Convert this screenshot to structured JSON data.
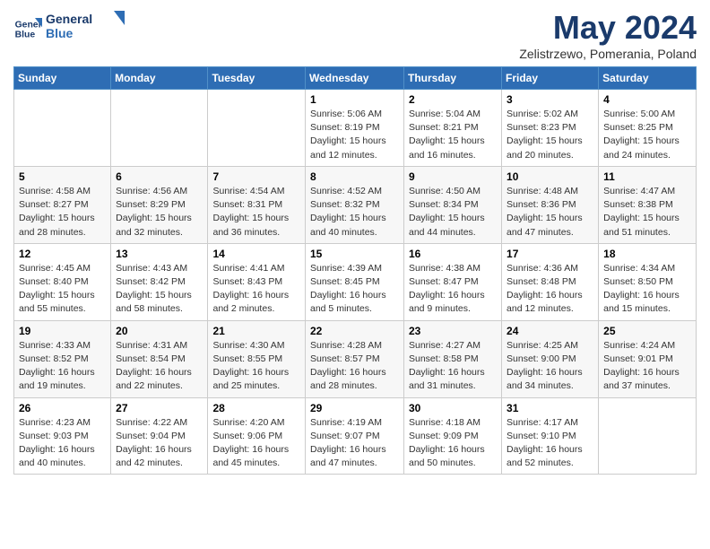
{
  "header": {
    "logo_line1": "General",
    "logo_line2": "Blue",
    "month_title": "May 2024",
    "subtitle": "Zelistrzewo, Pomerania, Poland"
  },
  "weekdays": [
    "Sunday",
    "Monday",
    "Tuesday",
    "Wednesday",
    "Thursday",
    "Friday",
    "Saturday"
  ],
  "weeks": [
    [
      {
        "day": "",
        "info": ""
      },
      {
        "day": "",
        "info": ""
      },
      {
        "day": "",
        "info": ""
      },
      {
        "day": "1",
        "info": "Sunrise: 5:06 AM\nSunset: 8:19 PM\nDaylight: 15 hours\nand 12 minutes."
      },
      {
        "day": "2",
        "info": "Sunrise: 5:04 AM\nSunset: 8:21 PM\nDaylight: 15 hours\nand 16 minutes."
      },
      {
        "day": "3",
        "info": "Sunrise: 5:02 AM\nSunset: 8:23 PM\nDaylight: 15 hours\nand 20 minutes."
      },
      {
        "day": "4",
        "info": "Sunrise: 5:00 AM\nSunset: 8:25 PM\nDaylight: 15 hours\nand 24 minutes."
      }
    ],
    [
      {
        "day": "5",
        "info": "Sunrise: 4:58 AM\nSunset: 8:27 PM\nDaylight: 15 hours\nand 28 minutes."
      },
      {
        "day": "6",
        "info": "Sunrise: 4:56 AM\nSunset: 8:29 PM\nDaylight: 15 hours\nand 32 minutes."
      },
      {
        "day": "7",
        "info": "Sunrise: 4:54 AM\nSunset: 8:31 PM\nDaylight: 15 hours\nand 36 minutes."
      },
      {
        "day": "8",
        "info": "Sunrise: 4:52 AM\nSunset: 8:32 PM\nDaylight: 15 hours\nand 40 minutes."
      },
      {
        "day": "9",
        "info": "Sunrise: 4:50 AM\nSunset: 8:34 PM\nDaylight: 15 hours\nand 44 minutes."
      },
      {
        "day": "10",
        "info": "Sunrise: 4:48 AM\nSunset: 8:36 PM\nDaylight: 15 hours\nand 47 minutes."
      },
      {
        "day": "11",
        "info": "Sunrise: 4:47 AM\nSunset: 8:38 PM\nDaylight: 15 hours\nand 51 minutes."
      }
    ],
    [
      {
        "day": "12",
        "info": "Sunrise: 4:45 AM\nSunset: 8:40 PM\nDaylight: 15 hours\nand 55 minutes."
      },
      {
        "day": "13",
        "info": "Sunrise: 4:43 AM\nSunset: 8:42 PM\nDaylight: 15 hours\nand 58 minutes."
      },
      {
        "day": "14",
        "info": "Sunrise: 4:41 AM\nSunset: 8:43 PM\nDaylight: 16 hours\nand 2 minutes."
      },
      {
        "day": "15",
        "info": "Sunrise: 4:39 AM\nSunset: 8:45 PM\nDaylight: 16 hours\nand 5 minutes."
      },
      {
        "day": "16",
        "info": "Sunrise: 4:38 AM\nSunset: 8:47 PM\nDaylight: 16 hours\nand 9 minutes."
      },
      {
        "day": "17",
        "info": "Sunrise: 4:36 AM\nSunset: 8:48 PM\nDaylight: 16 hours\nand 12 minutes."
      },
      {
        "day": "18",
        "info": "Sunrise: 4:34 AM\nSunset: 8:50 PM\nDaylight: 16 hours\nand 15 minutes."
      }
    ],
    [
      {
        "day": "19",
        "info": "Sunrise: 4:33 AM\nSunset: 8:52 PM\nDaylight: 16 hours\nand 19 minutes."
      },
      {
        "day": "20",
        "info": "Sunrise: 4:31 AM\nSunset: 8:54 PM\nDaylight: 16 hours\nand 22 minutes."
      },
      {
        "day": "21",
        "info": "Sunrise: 4:30 AM\nSunset: 8:55 PM\nDaylight: 16 hours\nand 25 minutes."
      },
      {
        "day": "22",
        "info": "Sunrise: 4:28 AM\nSunset: 8:57 PM\nDaylight: 16 hours\nand 28 minutes."
      },
      {
        "day": "23",
        "info": "Sunrise: 4:27 AM\nSunset: 8:58 PM\nDaylight: 16 hours\nand 31 minutes."
      },
      {
        "day": "24",
        "info": "Sunrise: 4:25 AM\nSunset: 9:00 PM\nDaylight: 16 hours\nand 34 minutes."
      },
      {
        "day": "25",
        "info": "Sunrise: 4:24 AM\nSunset: 9:01 PM\nDaylight: 16 hours\nand 37 minutes."
      }
    ],
    [
      {
        "day": "26",
        "info": "Sunrise: 4:23 AM\nSunset: 9:03 PM\nDaylight: 16 hours\nand 40 minutes."
      },
      {
        "day": "27",
        "info": "Sunrise: 4:22 AM\nSunset: 9:04 PM\nDaylight: 16 hours\nand 42 minutes."
      },
      {
        "day": "28",
        "info": "Sunrise: 4:20 AM\nSunset: 9:06 PM\nDaylight: 16 hours\nand 45 minutes."
      },
      {
        "day": "29",
        "info": "Sunrise: 4:19 AM\nSunset: 9:07 PM\nDaylight: 16 hours\nand 47 minutes."
      },
      {
        "day": "30",
        "info": "Sunrise: 4:18 AM\nSunset: 9:09 PM\nDaylight: 16 hours\nand 50 minutes."
      },
      {
        "day": "31",
        "info": "Sunrise: 4:17 AM\nSunset: 9:10 PM\nDaylight: 16 hours\nand 52 minutes."
      },
      {
        "day": "",
        "info": ""
      }
    ]
  ]
}
